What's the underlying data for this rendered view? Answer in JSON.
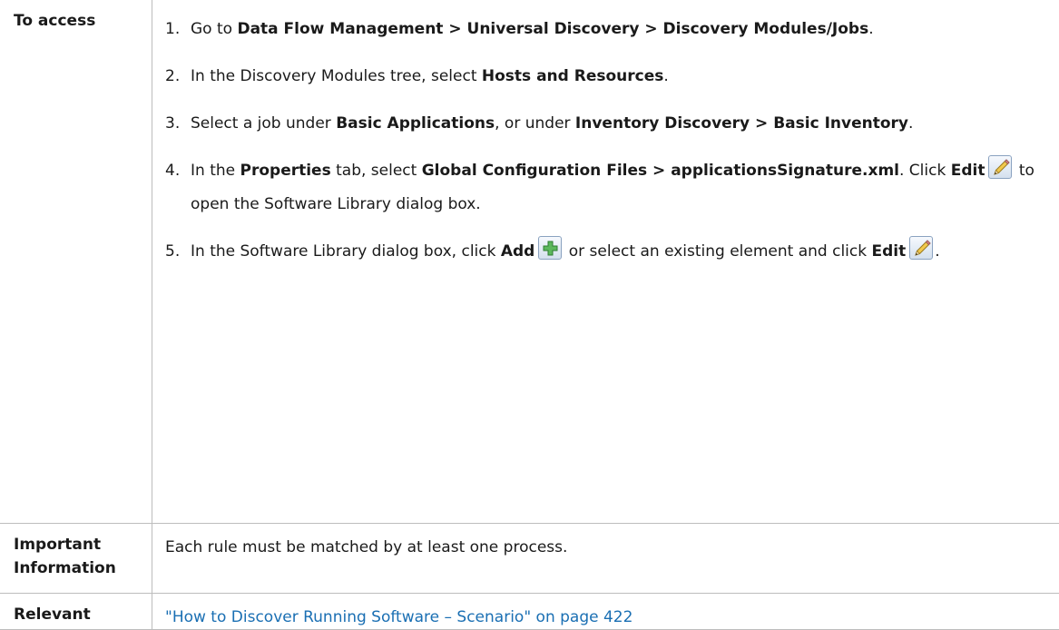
{
  "rows": {
    "access": {
      "header": "To access",
      "steps": [
        {
          "num": "1.",
          "t1": "Go to ",
          "b1": "Data Flow Management > Universal Discovery > Discovery Modules/Jobs",
          "t2": "."
        },
        {
          "num": "2.",
          "t1": "In the Discovery Modules tree, select ",
          "b1": "Hosts and Resources",
          "t2": "."
        },
        {
          "num": "3.",
          "t1": "Select a job under ",
          "b1": "Basic Applications",
          "t2": ", or under ",
          "b2": "Inventory Discovery > Basic Inventory",
          "t3": "."
        },
        {
          "num": "4.",
          "t1": "In the ",
          "b1": "Properties",
          "t2": " tab, select ",
          "b2": "Global Configuration Files > applicationsSignature.xml",
          "t3": ". Click ",
          "b3": "Edit",
          "icon": "pencil-edit-icon",
          "t4": " to open the Software Library dialog box."
        },
        {
          "num": "5.",
          "t1": "In the Software Library dialog box, click ",
          "b1": "Add",
          "icon1": "green-plus-add-icon",
          "t2": " or select an existing element and click ",
          "b2": "Edit",
          "icon2": "pencil-edit-icon",
          "t3": "."
        }
      ]
    },
    "important": {
      "header": "Important Information",
      "text": "Each rule must be matched by at least one process."
    },
    "relevant": {
      "header": "Relevant",
      "link": "\"How to Discover Running Software – Scenario\" on page 422"
    }
  },
  "colors": {
    "link": "#1a6fb3",
    "border": "#bdbdbd",
    "text": "#1a1a1a"
  }
}
